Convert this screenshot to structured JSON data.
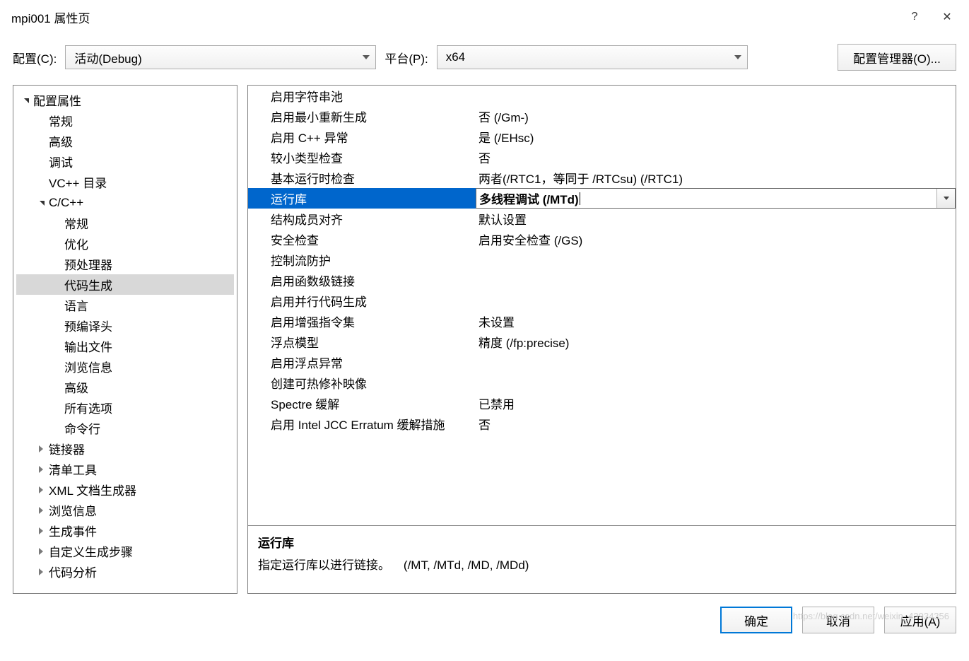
{
  "titlebar": {
    "title": "mpi001 属性页"
  },
  "toolbar": {
    "config_label": "配置(C):",
    "config_value": "活动(Debug)",
    "platform_label": "平台(P):",
    "platform_value": "x64",
    "manager_button": "配置管理器(O)..."
  },
  "tree": {
    "root": "配置属性",
    "items_l1a": [
      "常规",
      "高级",
      "调试",
      "VC++ 目录"
    ],
    "cpp": "C/C++",
    "cpp_items": [
      "常规",
      "优化",
      "预处理器",
      "代码生成",
      "语言",
      "预编译头",
      "输出文件",
      "浏览信息",
      "高级",
      "所有选项",
      "命令行"
    ],
    "items_l1b": [
      "链接器",
      "清单工具",
      "XML 文档生成器",
      "浏览信息",
      "生成事件",
      "自定义生成步骤",
      "代码分析"
    ]
  },
  "grid": {
    "rows": [
      {
        "label": "启用字符串池",
        "value": ""
      },
      {
        "label": "启用最小重新生成",
        "value": "否 (/Gm-)"
      },
      {
        "label": "启用 C++ 异常",
        "value": "是 (/EHsc)"
      },
      {
        "label": "较小类型检查",
        "value": "否"
      },
      {
        "label": "基本运行时检查",
        "value": "两者(/RTC1，等同于 /RTCsu) (/RTC1)"
      },
      {
        "label": "运行库",
        "value": "多线程调试 (/MTd)",
        "selected": true
      },
      {
        "label": "结构成员对齐",
        "value": "默认设置"
      },
      {
        "label": "安全检查",
        "value": "启用安全检查 (/GS)"
      },
      {
        "label": "控制流防护",
        "value": ""
      },
      {
        "label": "启用函数级链接",
        "value": ""
      },
      {
        "label": "启用并行代码生成",
        "value": ""
      },
      {
        "label": "启用增强指令集",
        "value": "未设置"
      },
      {
        "label": "浮点模型",
        "value": "精度 (/fp:precise)"
      },
      {
        "label": "启用浮点异常",
        "value": ""
      },
      {
        "label": "创建可热修补映像",
        "value": ""
      },
      {
        "label": "Spectre 缓解",
        "value": "已禁用"
      },
      {
        "label": "启用 Intel JCC Erratum 缓解措施",
        "value": "否"
      }
    ]
  },
  "desc": {
    "title": "运行库",
    "text": "指定运行库以进行链接。",
    "hint": "(/MT, /MTd, /MD, /MDd)"
  },
  "footer": {
    "ok": "确定",
    "cancel": "取消",
    "apply": "应用(A)"
  }
}
